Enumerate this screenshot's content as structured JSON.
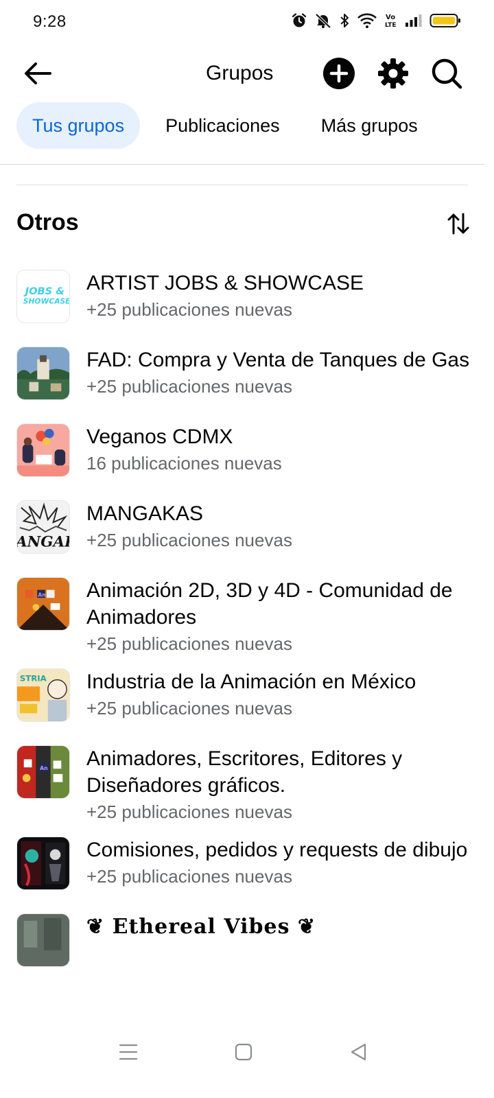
{
  "status_bar": {
    "time": "9:28",
    "icons": [
      "alarm-icon",
      "mute-icon",
      "bluetooth-icon",
      "wifi-icon",
      "volte-icon",
      "signal-icon",
      "battery-icon"
    ],
    "volte_label": "Vo\nLTE"
  },
  "header": {
    "title": "Grupos",
    "back_icon": "arrow-left-icon",
    "actions": [
      "plus-circle-icon",
      "gear-icon",
      "search-icon"
    ]
  },
  "tabs": [
    {
      "label": "Tus grupos",
      "active": true
    },
    {
      "label": "Publicaciones",
      "active": false
    },
    {
      "label": "Más grupos",
      "active": false
    }
  ],
  "section": {
    "title": "Otros",
    "sort_icon": "sort-arrows-icon"
  },
  "groups": [
    {
      "name": "ARTIST JOBS & SHOWCASE",
      "sub": "+25 publicaciones nuevas",
      "thumb_text": "JOBS & SHOWCASE"
    },
    {
      "name": "FAD: Compra y Venta de Tanques de Gas",
      "sub": "+25 publicaciones nuevas"
    },
    {
      "name": "Veganos CDMX",
      "sub": "16 publicaciones nuevas"
    },
    {
      "name": "MANGAKAS",
      "sub": "+25 publicaciones nuevas",
      "thumb_text": "ANGAK"
    },
    {
      "name": "Animación 2D, 3D y 4D - Comunidad de Animadores",
      "sub": "+25 publicaciones nuevas",
      "thumb_text": "An"
    },
    {
      "name": "Industria de la Animación en México",
      "sub": "+25 publicaciones nuevas"
    },
    {
      "name": "Animadores, Escritores, Editores y Diseñadores gráficos.",
      "sub": "+25 publicaciones nuevas",
      "thumb_text": "An"
    },
    {
      "name": "Comisiones, pedidos y requests de dibujo",
      "sub": "+25 publicaciones nuevas"
    },
    {
      "name": "❦ Ethereal Vibes ❦",
      "sub": ""
    }
  ],
  "nav_bar": {
    "icons": [
      "menu-icon",
      "home-square-icon",
      "back-triangle-icon"
    ]
  },
  "colors": {
    "accent": "#0a66d6",
    "tab_active_bg": "#e7f0fd",
    "secondary_text": "#65676b",
    "battery": "#f5c518"
  }
}
